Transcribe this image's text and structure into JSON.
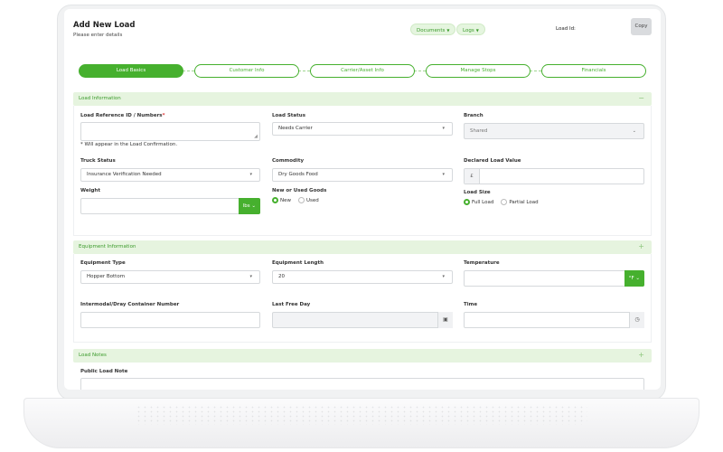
{
  "header": {
    "title": "Add New Load",
    "subtitle": "Please enter details",
    "documents_label": "Documents",
    "logs_label": "Logs",
    "load_id_label": "Load Id:",
    "copy_label": "Copy"
  },
  "steps": [
    {
      "label": "Load Basics",
      "active": true
    },
    {
      "label": "Customer Info",
      "active": false
    },
    {
      "label": "Carrier/Asset Info",
      "active": false
    },
    {
      "label": "Manage Stops",
      "active": false
    },
    {
      "label": "Financials",
      "active": false
    }
  ],
  "load_information": {
    "section_title": "Load Information",
    "toggle": "−",
    "reference_label": "Load Reference ID / Numbers",
    "reference_value": "",
    "reference_note": "* Will appear in the Load Confirmation.",
    "load_status_label": "Load Status",
    "load_status_value": "Needs Carrier",
    "branch_label": "Branch",
    "branch_value": "Shared",
    "truck_status_label": "Truck Status",
    "truck_status_value": "Insurance Verification Needed",
    "commodity_label": "Commodity",
    "commodity_value": "Dry Goods Food",
    "declared_value_label": "Declared Load Value",
    "currency_symbol": "£",
    "declared_value": "",
    "weight_label": "Weight",
    "weight_value": "",
    "weight_unit": "lbs",
    "goods_label": "New or Used Goods",
    "goods_options": [
      "New",
      "Used"
    ],
    "goods_selected": "New",
    "size_label": "Load Size",
    "size_options": [
      "Full Load",
      "Partial Load"
    ],
    "size_selected": "Full Load"
  },
  "equipment_information": {
    "section_title": "Equipment Information",
    "toggle": "+",
    "type_label": "Equipment Type",
    "type_value": "Hopper Bottom",
    "length_label": "Equipment Length",
    "length_value": "20",
    "temperature_label": "Temperature",
    "temperature_value": "",
    "temperature_unit": "°F",
    "container_label": "Intermodal/Dray Container Number",
    "container_value": "",
    "last_free_day_label": "Last Free Day",
    "last_free_day_value": "",
    "time_label": "Time",
    "time_value": ""
  },
  "load_notes": {
    "section_title": "Load Notes",
    "toggle": "+",
    "public_note_label": "Public Load Note"
  },
  "colors": {
    "accent": "#46b02e",
    "accent_light": "#e6f4df"
  }
}
